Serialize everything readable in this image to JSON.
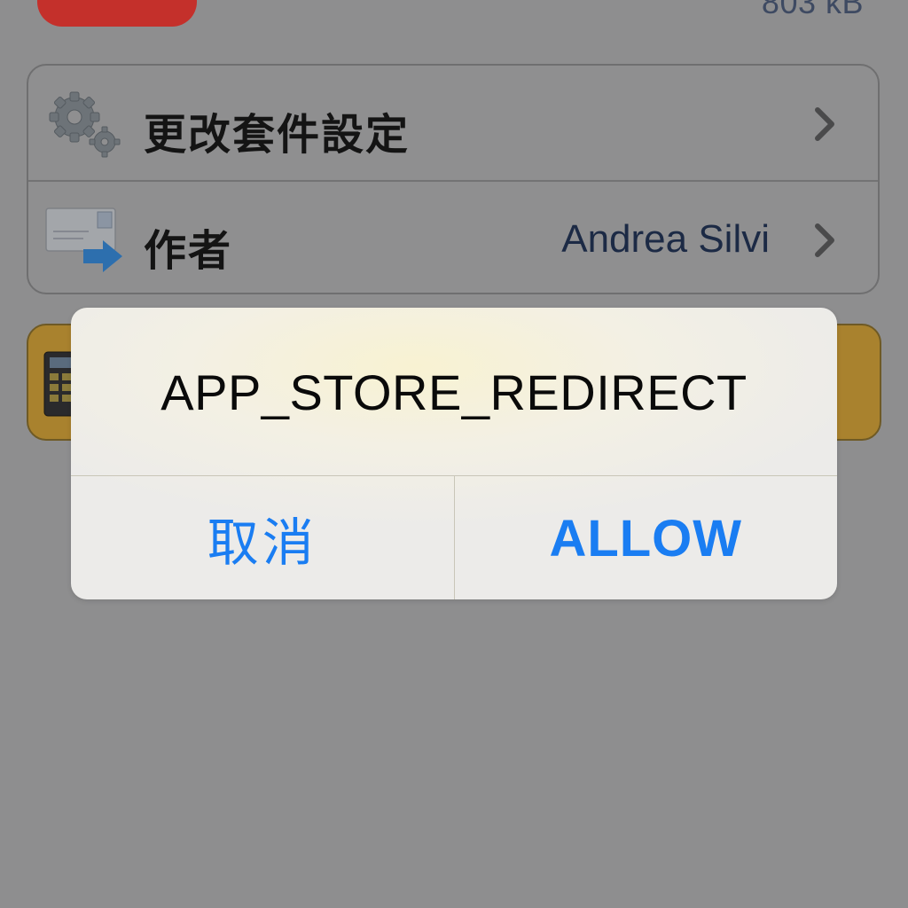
{
  "background": {
    "package_size": "803 kB",
    "rows": [
      {
        "label": "更改套件設定",
        "detail": "",
        "icon": "gears-icon"
      },
      {
        "label": "作者",
        "detail": "Andrea Silvi",
        "icon": "mail-forward-icon"
      }
    ]
  },
  "alert": {
    "title": "APP_STORE_REDIRECT",
    "cancel_label": "取消",
    "allow_label": "ALLOW"
  },
  "colors": {
    "dim_background": "#8e8e8f",
    "alert_button_text": "#1a7df2",
    "banner": "#a9822e"
  }
}
